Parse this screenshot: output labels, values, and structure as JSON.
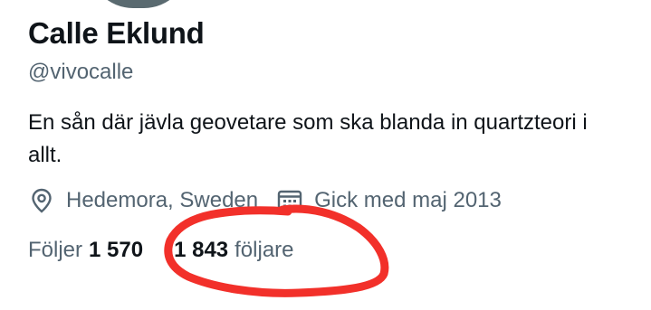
{
  "profile": {
    "name": "Calle Eklund",
    "handle": "@vivocalle",
    "bio": "En sån där jävla geovetare som ska blanda in quartzteori i allt.",
    "location": "Hedemora, Sweden",
    "joined": "Gick med maj 2013"
  },
  "stats": {
    "following_label": "Följer",
    "following_count": "1 570",
    "followers_count": "1 843",
    "followers_label": "följare"
  },
  "icons": {
    "location": "location-pin-icon",
    "joined": "calendar-icon"
  },
  "colors": {
    "text": "#0f1419",
    "secondary": "#536471",
    "annotation": "#f2302a"
  }
}
